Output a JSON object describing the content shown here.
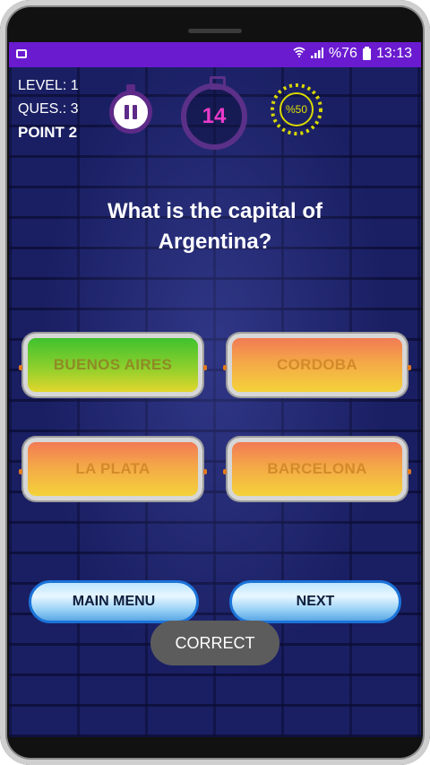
{
  "status_bar": {
    "battery": "%76",
    "time": "13:13",
    "icons": [
      "image-icon",
      "wifi-icon",
      "signal-icon",
      "battery-icon"
    ],
    "color": "#6a1bd0"
  },
  "stats": {
    "level": "LEVEL: 1",
    "question_no": "QUES.: 3",
    "point": "POINT 2"
  },
  "controls": {
    "timer": "14",
    "fifty_fifty": "%50"
  },
  "question": "What is the capital of Argentina?",
  "answers": [
    {
      "label": "BUENOS AIRES",
      "state": "correct"
    },
    {
      "label": "CORDOBA",
      "state": "default"
    },
    {
      "label": "LA PLATA",
      "state": "default"
    },
    {
      "label": "BARCELONA",
      "state": "default"
    }
  ],
  "buttons": {
    "main_menu": "MAIN MENU",
    "next": "NEXT"
  },
  "toast": "CORRECT",
  "colors": {
    "background": "#1a1f63",
    "accent_purple": "#5b3088",
    "timer_text": "#e83bc9",
    "correct_green": "#3fc22f",
    "answer_orange": "#f4a848"
  }
}
